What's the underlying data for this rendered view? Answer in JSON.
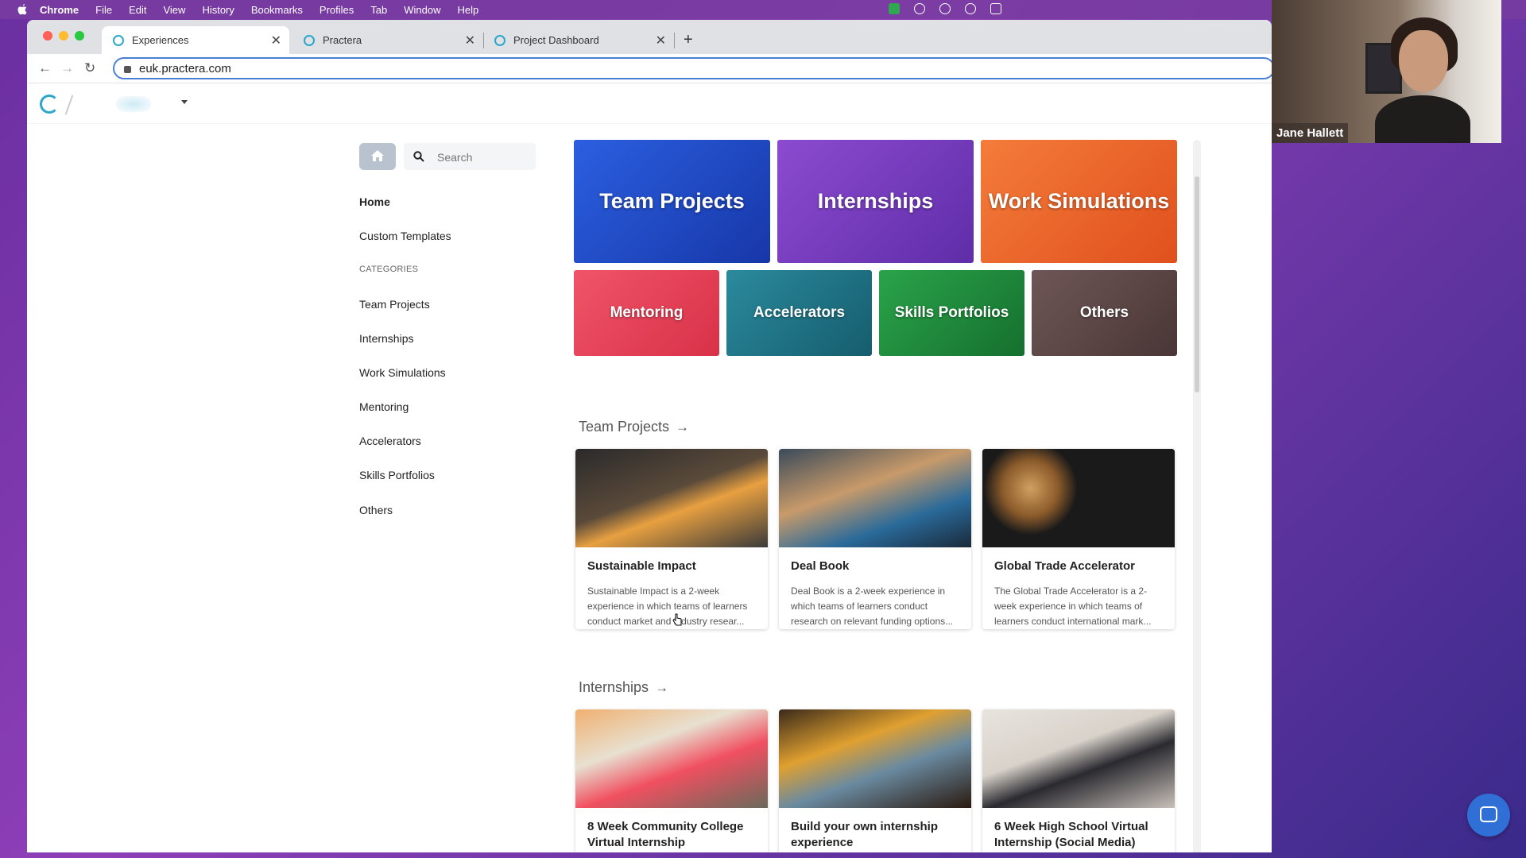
{
  "menubar": {
    "items": [
      "Chrome",
      "File",
      "Edit",
      "View",
      "History",
      "Bookmarks",
      "Profiles",
      "Tab",
      "Window",
      "Help"
    ]
  },
  "browser": {
    "tabs": [
      {
        "title": "Experiences",
        "active": true
      },
      {
        "title": "Practera",
        "active": false
      },
      {
        "title": "Project Dashboard",
        "active": false
      }
    ],
    "url": "euk.practera.com"
  },
  "sidebar": {
    "search_placeholder": "Search",
    "home_label": "Home",
    "custom_templates_label": "Custom Templates",
    "categories_heading": "CATEGORIES",
    "categories": [
      "Team Projects",
      "Internships",
      "Work Simulations",
      "Mentoring",
      "Accelerators",
      "Skills Portfolios",
      "Others"
    ]
  },
  "tiles": {
    "big": [
      {
        "label": "Team Projects",
        "color": "#1f4fd1"
      },
      {
        "label": "Internships",
        "color": "#7a3fc4"
      },
      {
        "label": "Work Simulations",
        "color": "#ef6a2a"
      }
    ],
    "small": [
      {
        "label": "Mentoring",
        "color": "#e84458"
      },
      {
        "label": "Accelerators",
        "color": "#1e7485"
      },
      {
        "label": "Skills Portfolios",
        "color": "#1e8a3a"
      },
      {
        "label": "Others",
        "color": "#5b4747"
      }
    ]
  },
  "sections": [
    {
      "title": "Team Projects",
      "cards": [
        {
          "title": "Sustainable Impact",
          "description": "Sustainable Impact is a 2-week experience in which teams of learners conduct market and industry resear..."
        },
        {
          "title": "Deal Book",
          "description": "Deal Book is a 2-week experience in which teams of learners conduct research on relevant funding options..."
        },
        {
          "title": "Global Trade Accelerator",
          "description": "The Global Trade Accelerator is a 2-week experience in which teams of learners conduct international mark..."
        }
      ]
    },
    {
      "title": "Internships",
      "cards": [
        {
          "title": "8 Week Community College Virtual Internship",
          "description": ""
        },
        {
          "title": "Build your own internship experience",
          "description": ""
        },
        {
          "title": "6 Week High School Virtual Internship (Social Media)",
          "description": ""
        }
      ]
    }
  ],
  "video": {
    "participant_name": "Jane Hallett"
  }
}
